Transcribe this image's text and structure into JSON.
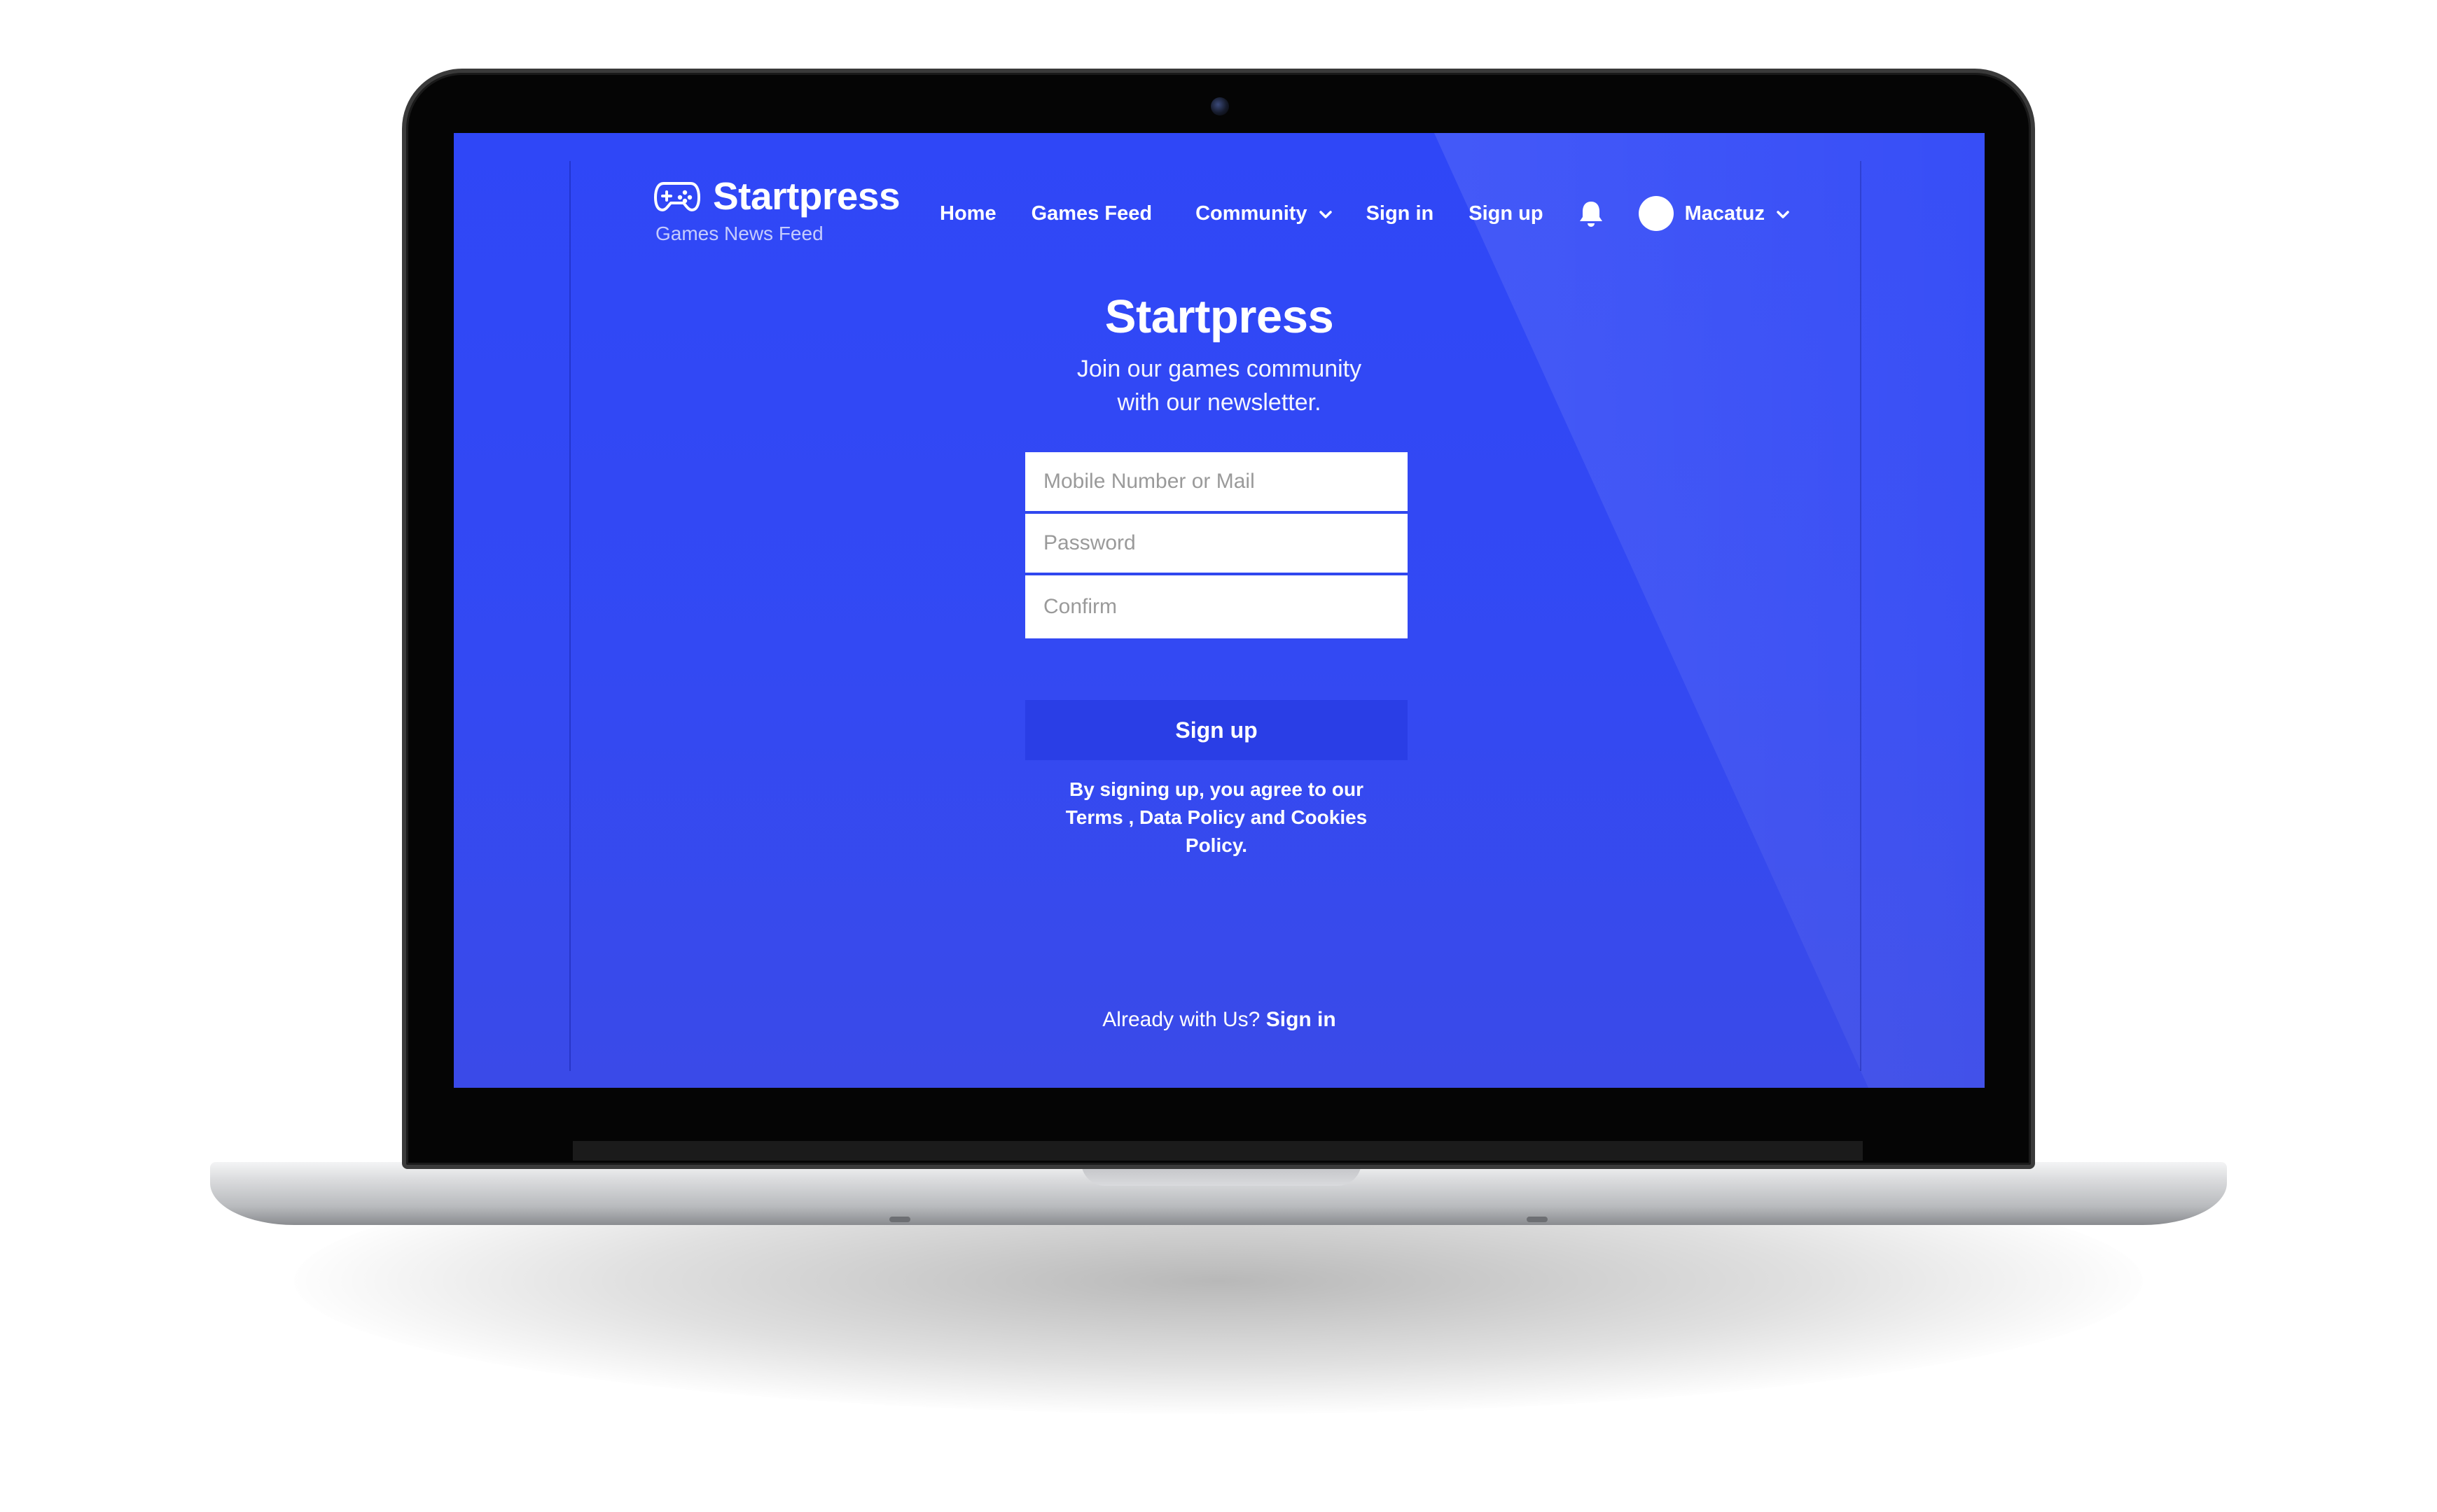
{
  "brand": {
    "name": "Startpress",
    "tagline": "Games News Feed",
    "icon": "gamepad-icon"
  },
  "nav": {
    "home": "Home",
    "games_feed": "Games Feed",
    "community": "Community",
    "sign_in": "Sign in",
    "sign_up": "Sign up",
    "notifications_icon": "bell-icon",
    "user_name": "Macatuz"
  },
  "hero": {
    "title": "Startpress",
    "subtitle_line1": "Join our games community",
    "subtitle_line2": "with our newsletter."
  },
  "form": {
    "contact_placeholder": "Mobile Number or Mail",
    "password_placeholder": "Password",
    "confirm_placeholder": "Confirm",
    "submit_label": "Sign up",
    "terms_line1": "By signing up, you agree to our",
    "terms_line2": "Terms , Data Policy and Cookies",
    "terms_line3": "Policy."
  },
  "footer": {
    "prompt": "Already with Us?",
    "sign_in_link": "Sign in"
  },
  "colors": {
    "screen_background": "#2f47f7",
    "button_background": "#2a3ee6",
    "text": "#ffffff"
  }
}
